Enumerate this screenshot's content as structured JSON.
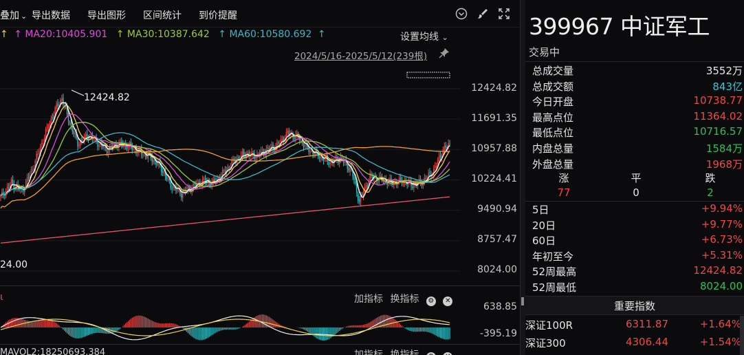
{
  "toolbar": {
    "overlay_label": "叠加",
    "export_data": "导出数据",
    "export_chart": "导出图形",
    "interval_stats": "区间统计",
    "price_alert": "到价提醒"
  },
  "ma": {
    "ma20": "MA20:10405.901",
    "ma30": "MA30:10387.642",
    "ma60": "MA60:10580.692",
    "settings_label": "设置均线",
    "colors": {
      "ma5": "#f0f0f0",
      "ma10": "#f2d24a",
      "ma20": "#d84fd8",
      "ma30": "#9ccc3a",
      "ma60": "#3fb6c6",
      "ma120": "#f0a030",
      "ma250": "#e8556a"
    }
  },
  "range_label": "2024/5/16-2025/5/12(239根)",
  "price_axis": [
    "12424.82",
    "11691.35",
    "10957.88",
    "10224.41",
    "9490.94",
    "8757.47",
    "8024.00"
  ],
  "high_annotation": "12424.82",
  "low_annotation": "24.00",
  "macd": {
    "toolbar": {
      "add": "加指标",
      "switch": "换指标"
    },
    "axis_top": "638.85",
    "axis_bottom": "-395.19"
  },
  "volume": {
    "label": "MAVOL2:18250693.384",
    "toolbar": {
      "add": "加指标",
      "switch": "换指标"
    }
  },
  "stock": {
    "title": "399967 中证军工",
    "status": "交易中",
    "stats": [
      {
        "k": "总成交量",
        "v": "3552万",
        "color": "white"
      },
      {
        "k": "总成交额",
        "v": "843亿",
        "color": "cyan"
      },
      {
        "k": "今日开盘",
        "v": "10738.77",
        "color": "red"
      },
      {
        "k": "最高点位",
        "v": "11364.02",
        "color": "red"
      },
      {
        "k": "最低点位",
        "v": "10716.57",
        "color": "green"
      },
      {
        "k": "内盘总量",
        "v": "1584万",
        "color": "green"
      },
      {
        "k": "外盘总量",
        "v": "1968万",
        "color": "red"
      }
    ],
    "updown": {
      "up_label": "涨",
      "flat_label": "平",
      "down_label": "跌",
      "up": "77",
      "flat": "0",
      "down": "2"
    },
    "perf": [
      {
        "k": "5日",
        "v": "+9.94%",
        "color": "red"
      },
      {
        "k": "20日",
        "v": "+9.77%",
        "color": "red"
      },
      {
        "k": "60日",
        "v": "+6.73%",
        "color": "red"
      },
      {
        "k": "年初至今",
        "v": "+5.31%",
        "color": "red"
      },
      {
        "k": "52周最高",
        "v": "12424.82",
        "color": "red"
      },
      {
        "k": "52周最低",
        "v": "8024.00",
        "color": "green"
      }
    ]
  },
  "indices": {
    "header": "重要指数",
    "items": [
      {
        "name": "深证100R",
        "price": "6311.87",
        "chg": "+1.64%"
      },
      {
        "name": "深证300",
        "price": "4306.44",
        "chg": "+1.54%"
      }
    ]
  },
  "colors": {
    "up": "#ef4848",
    "down": "#2bc4c8",
    "bg": "#0b0b0d"
  }
}
